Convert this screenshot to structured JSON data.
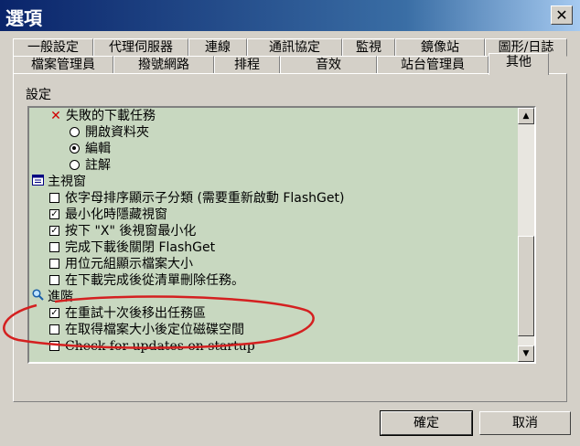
{
  "window": {
    "title": "選項",
    "close_glyph": "✕"
  },
  "tabs_row1": [
    "一般設定",
    "代理伺服器",
    "連線",
    "通訊協定",
    "監視",
    "鏡像站",
    "圖形/日誌"
  ],
  "tabs_row2": [
    "檔案管理員",
    "撥號網路",
    "排程",
    "音效",
    "站台管理員",
    "其他"
  ],
  "active_tab": "其他",
  "settings_label": "設定",
  "tree": {
    "failed_task": {
      "label": "失敗的下載任務",
      "icon": "red-x-icon"
    },
    "open_folder": {
      "label": "開啟資料夾",
      "selected": false
    },
    "edit": {
      "label": "編輯",
      "selected": true
    },
    "comment": {
      "label": "註解",
      "selected": false
    },
    "main_window": {
      "label": "主視窗",
      "icon": "window-icon"
    },
    "sort_alpha": {
      "label": "依字母排序顯示子分類 (需要重新啟動 FlashGet)",
      "checked": false
    },
    "hide_minimized": {
      "label": "最小化時隱藏視窗",
      "checked": true
    },
    "x_minimize": {
      "label": "按下 \"X\" 後視窗最小化",
      "checked": true
    },
    "close_after": {
      "label": "完成下載後關閉 FlashGet",
      "checked": false
    },
    "show_bytes": {
      "label": "用位元組顯示檔案大小",
      "checked": false
    },
    "remove_list": {
      "label": "在下載完成後從清單刪除任務。",
      "checked": false
    },
    "advanced": {
      "label": "進階",
      "icon": "magnifier-icon"
    },
    "retry_remove": {
      "label": "在重試十次後移出任務區",
      "checked": true
    },
    "allocate_space": {
      "label": "在取得檔案大小後定位磁碟空間",
      "checked": false
    },
    "check_updates": {
      "label": "Check for updates on startup",
      "checked": false
    }
  },
  "buttons": {
    "ok": "確定",
    "cancel": "取消"
  },
  "colors": {
    "list_bg": "#c8d8c0",
    "annotation_ellipse": "#d42020",
    "red_x": "#d00000"
  }
}
